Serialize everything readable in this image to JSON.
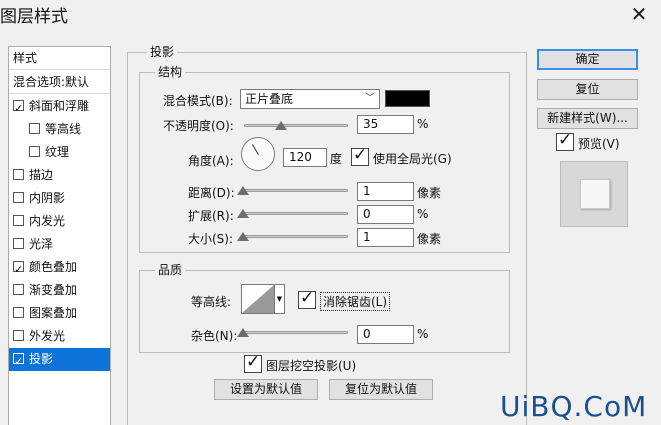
{
  "window": {
    "title": "图层样式"
  },
  "left_panel": {
    "header": "样式",
    "blend_options": "混合选项:默认",
    "items": [
      {
        "label": "斜面和浮雕",
        "checked": true,
        "indent": false
      },
      {
        "label": "等高线",
        "checked": false,
        "indent": true
      },
      {
        "label": "纹理",
        "checked": false,
        "indent": true
      },
      {
        "label": "描边",
        "checked": false,
        "indent": false
      },
      {
        "label": "内阴影",
        "checked": false,
        "indent": false
      },
      {
        "label": "内发光",
        "checked": false,
        "indent": false
      },
      {
        "label": "光泽",
        "checked": false,
        "indent": false
      },
      {
        "label": "颜色叠加",
        "checked": true,
        "indent": false
      },
      {
        "label": "渐变叠加",
        "checked": false,
        "indent": false
      },
      {
        "label": "图案叠加",
        "checked": false,
        "indent": false
      },
      {
        "label": "外发光",
        "checked": false,
        "indent": false
      },
      {
        "label": "投影",
        "checked": true,
        "indent": false,
        "selected": true
      }
    ]
  },
  "drop_shadow": {
    "legend": "投影",
    "structure": {
      "legend": "结构",
      "blend_mode_label": "混合模式(B):",
      "blend_mode_value": "正片叠底",
      "color": "#000000",
      "opacity_label": "不透明度(O):",
      "opacity_value": "35",
      "opacity_unit": "%",
      "angle_label": "角度(A):",
      "angle_value": "120",
      "angle_unit": "度",
      "global_light_label": "使用全局光(G)",
      "global_light_checked": true,
      "distance_label": "距离(D):",
      "distance_value": "1",
      "distance_unit": "像素",
      "spread_label": "扩展(R):",
      "spread_value": "0",
      "spread_unit": "%",
      "size_label": "大小(S):",
      "size_value": "1",
      "size_unit": "像素"
    },
    "quality": {
      "legend": "品质",
      "contour_label": "等高线:",
      "antialias_label": "消除锯齿(L)",
      "antialias_checked": true,
      "noise_label": "杂色(N):",
      "noise_value": "0",
      "noise_unit": "%"
    },
    "knockout_label": "图层挖空投影(U)",
    "knockout_checked": true,
    "make_default": "设置为默认值",
    "reset_default": "复位为默认值"
  },
  "buttons": {
    "ok": "确定",
    "reset": "复位",
    "new_style": "新建样式(W)...",
    "preview_label": "预览(V)",
    "preview_checked": true
  },
  "watermark": "UiBQ.CoM"
}
